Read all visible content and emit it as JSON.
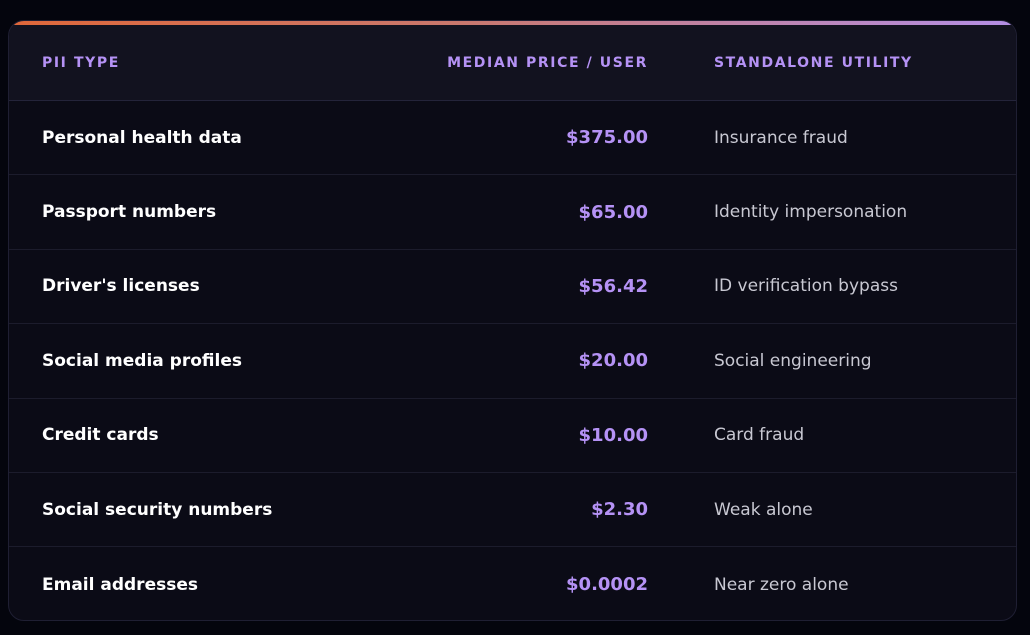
{
  "table": {
    "headers": {
      "pii_type": "PII TYPE",
      "median_price": "MEDIAN PRICE / USER",
      "standalone_utility": "STANDALONE UTILITY"
    },
    "rows": [
      {
        "type": "Personal health data",
        "price": "$375.00",
        "utility": "Insurance fraud"
      },
      {
        "type": "Passport numbers",
        "price": "$65.00",
        "utility": "Identity impersonation"
      },
      {
        "type": "Driver's licenses",
        "price": "$56.42",
        "utility": "ID verification bypass"
      },
      {
        "type": "Social media profiles",
        "price": "$20.00",
        "utility": "Social engineering"
      },
      {
        "type": "Credit cards",
        "price": "$10.00",
        "utility": "Card fraud"
      },
      {
        "type": "Social security numbers",
        "price": "$2.30",
        "utility": "Weak alone"
      },
      {
        "type": "Email addresses",
        "price": "$0.0002",
        "utility": "Near zero alone"
      }
    ]
  },
  "colors": {
    "accent_purple": "#b592f5",
    "accent_orange": "#e0683a",
    "background": "#04050d",
    "card": "#0b0b16"
  }
}
